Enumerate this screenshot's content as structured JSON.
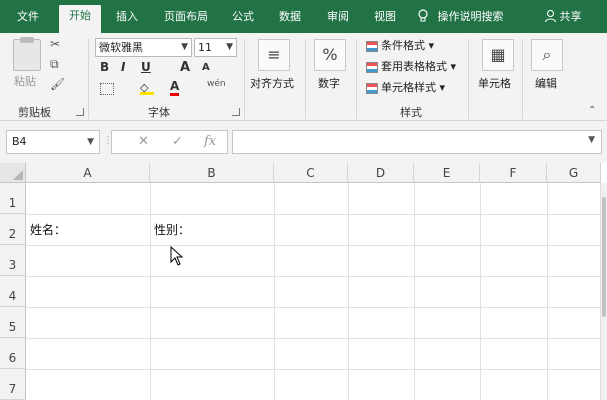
{
  "tabs": [
    "文件",
    "开始",
    "插入",
    "页面布局",
    "公式",
    "数据",
    "审阅",
    "视图"
  ],
  "active_tab": "开始",
  "tell_me": "操作说明搜索",
  "share": "共享",
  "clipboard": {
    "paste_label": "粘贴",
    "group_label": "剪贴板"
  },
  "font": {
    "name": "微软雅黑",
    "size": "11",
    "bold": "B",
    "italic": "I",
    "underline": "U",
    "grow": "A",
    "shrink": "A",
    "font_color": "A",
    "wen": "wén",
    "group_label": "字体"
  },
  "alignment": {
    "label": "对齐方式"
  },
  "number": {
    "label": "数字",
    "symbol": "%"
  },
  "styles": {
    "conditional": "条件格式",
    "table": "套用表格格式",
    "cell_styles": "单元格样式",
    "group_label": "样式"
  },
  "cells": {
    "label": "单元格"
  },
  "editing": {
    "label": "编辑"
  },
  "formula_bar": {
    "name_box": "B4",
    "cancel": "✕",
    "enter": "✓",
    "fx": "fx",
    "value": ""
  },
  "columns": [
    "A",
    "B",
    "C",
    "D",
    "E",
    "F",
    "G"
  ],
  "rows": [
    "1",
    "2",
    "3",
    "4",
    "5",
    "6",
    "7"
  ],
  "cells_data": {
    "A2": "姓名：",
    "B2": "性别："
  },
  "colors": {
    "accent": "#217346"
  }
}
